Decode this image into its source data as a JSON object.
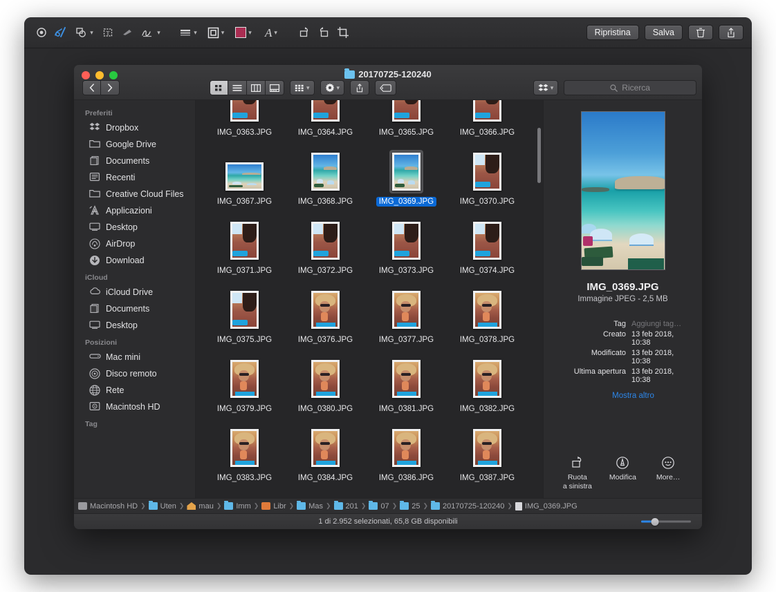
{
  "markup_toolbar": {
    "tools": [
      {
        "name": "instant-alpha-icon",
        "glyph": "◉"
      },
      {
        "name": "sketch-icon",
        "glyph": "✑"
      },
      {
        "name": "shapes-icon",
        "glyph": "⬠",
        "menu": true
      },
      {
        "name": "text-icon",
        "glyph": "T",
        "menu": false
      },
      {
        "name": "highlight-icon",
        "glyph": "▰"
      },
      {
        "name": "signature-icon",
        "glyph": "✍",
        "menu": true
      },
      {
        "name": "shape-style-icon",
        "glyph": "≡",
        "menu": true
      },
      {
        "name": "border-style-icon",
        "glyph": "▣",
        "menu": true
      },
      {
        "name": "fill-color-icon",
        "glyph": "",
        "menu": true
      },
      {
        "name": "text-style-icon",
        "glyph": "A",
        "menu": true
      },
      {
        "name": "rotate-left-icon",
        "glyph": "↺"
      },
      {
        "name": "rotate-right-icon",
        "glyph": "↻"
      },
      {
        "name": "crop-icon",
        "glyph": "⌗"
      }
    ],
    "fill_color": "#a92d52",
    "restore_label": "Ripristina",
    "save_label": "Salva",
    "delete_icon": "trash-icon",
    "share_icon": "share-icon"
  },
  "finder": {
    "title": "20170725-120240",
    "nav": {
      "back": "‹",
      "forward": "›"
    },
    "view_modes": [
      {
        "name": "icon-view",
        "active": true
      },
      {
        "name": "list-view",
        "active": false
      },
      {
        "name": "column-view",
        "active": false
      },
      {
        "name": "gallery-view",
        "active": false
      }
    ],
    "toolbar_buttons": [
      {
        "name": "arrange-by-button",
        "menu": true
      },
      {
        "name": "action-gear-button",
        "menu": true
      },
      {
        "name": "share-button",
        "menu": false
      },
      {
        "name": "tag-button",
        "menu": false
      },
      {
        "name": "dropbox-button",
        "menu": true
      }
    ],
    "search": {
      "placeholder": "Ricerca",
      "value": "",
      "icon": "search-icon"
    },
    "sidebar": {
      "sections": [
        {
          "title": "Preferiti",
          "items": [
            {
              "label": "Dropbox",
              "icon": "dropbox-icon"
            },
            {
              "label": "Google Drive",
              "icon": "folder-icon"
            },
            {
              "label": "Documents",
              "icon": "documents-icon"
            },
            {
              "label": "Recenti",
              "icon": "recents-icon"
            },
            {
              "label": "Creative Cloud Files",
              "icon": "folder-icon"
            },
            {
              "label": "Applicazioni",
              "icon": "applications-icon"
            },
            {
              "label": "Desktop",
              "icon": "desktop-icon"
            },
            {
              "label": "AirDrop",
              "icon": "airdrop-icon"
            },
            {
              "label": "Download",
              "icon": "download-icon"
            }
          ]
        },
        {
          "title": "iCloud",
          "items": [
            {
              "label": "iCloud Drive",
              "icon": "cloud-icon"
            },
            {
              "label": "Documents",
              "icon": "documents-icon"
            },
            {
              "label": "Desktop",
              "icon": "desktop-icon"
            }
          ]
        },
        {
          "title": "Posizioni",
          "items": [
            {
              "label": "Mac mini",
              "icon": "mac-mini-icon"
            },
            {
              "label": "Disco remoto",
              "icon": "remote-disc-icon"
            },
            {
              "label": "Rete",
              "icon": "network-icon"
            },
            {
              "label": "Macintosh HD",
              "icon": "hard-disk-icon"
            }
          ]
        },
        {
          "title": "Tag",
          "items": []
        }
      ]
    },
    "files": [
      {
        "name": "IMG_0363.JPG",
        "kind": "portrait",
        "photo": "selfie",
        "selected": false,
        "clipped": true
      },
      {
        "name": "IMG_0364.JPG",
        "kind": "portrait",
        "photo": "selfie",
        "selected": false,
        "clipped": true
      },
      {
        "name": "IMG_0365.JPG",
        "kind": "portrait",
        "photo": "selfie",
        "selected": false,
        "clipped": true
      },
      {
        "name": "IMG_0366.JPG",
        "kind": "portrait",
        "photo": "selfie",
        "selected": false,
        "clipped": true
      },
      {
        "name": "IMG_0367.JPG",
        "kind": "landscape",
        "photo": "beach",
        "selected": false,
        "clipped": false
      },
      {
        "name": "IMG_0368.JPG",
        "kind": "portrait",
        "photo": "beach",
        "selected": false,
        "clipped": false
      },
      {
        "name": "IMG_0369.JPG",
        "kind": "portrait",
        "photo": "beach",
        "selected": true,
        "clipped": false
      },
      {
        "name": "IMG_0370.JPG",
        "kind": "portrait",
        "photo": "selfie",
        "selected": false,
        "clipped": false
      },
      {
        "name": "IMG_0371.JPG",
        "kind": "portrait",
        "photo": "selfie",
        "selected": false,
        "clipped": false
      },
      {
        "name": "IMG_0372.JPG",
        "kind": "portrait",
        "photo": "selfie",
        "selected": false,
        "clipped": false
      },
      {
        "name": "IMG_0373.JPG",
        "kind": "portrait",
        "photo": "selfie",
        "selected": false,
        "clipped": false
      },
      {
        "name": "IMG_0374.JPG",
        "kind": "portrait",
        "photo": "selfie",
        "selected": false,
        "clipped": false
      },
      {
        "name": "IMG_0375.JPG",
        "kind": "portrait",
        "photo": "selfie",
        "selected": false,
        "clipped": false
      },
      {
        "name": "IMG_0376.JPG",
        "kind": "portrait",
        "photo": "portrait",
        "selected": false,
        "clipped": false
      },
      {
        "name": "IMG_0377.JPG",
        "kind": "portrait",
        "photo": "portrait",
        "selected": false,
        "clipped": false
      },
      {
        "name": "IMG_0378.JPG",
        "kind": "portrait",
        "photo": "portrait",
        "selected": false,
        "clipped": false
      },
      {
        "name": "IMG_0379.JPG",
        "kind": "portrait",
        "photo": "portrait",
        "selected": false,
        "clipped": false
      },
      {
        "name": "IMG_0380.JPG",
        "kind": "portrait",
        "photo": "portrait",
        "selected": false,
        "clipped": false
      },
      {
        "name": "IMG_0381.JPG",
        "kind": "portrait",
        "photo": "portrait",
        "selected": false,
        "clipped": false
      },
      {
        "name": "IMG_0382.JPG",
        "kind": "portrait",
        "photo": "portrait",
        "selected": false,
        "clipped": false
      },
      {
        "name": "IMG_0383.JPG",
        "kind": "portrait",
        "photo": "portrait",
        "selected": false,
        "clipped": false
      },
      {
        "name": "IMG_0384.JPG",
        "kind": "portrait",
        "photo": "portrait",
        "selected": false,
        "clipped": false
      },
      {
        "name": "IMG_0386.JPG",
        "kind": "portrait",
        "photo": "portrait",
        "selected": false,
        "clipped": false
      },
      {
        "name": "IMG_0387.JPG",
        "kind": "portrait",
        "photo": "portrait",
        "selected": false,
        "clipped": false
      }
    ],
    "preview": {
      "filename": "IMG_0369.JPG",
      "kind": "Immagine JPEG - 2,5 MB",
      "metadata": [
        {
          "key": "Tag",
          "value": "Aggiungi tag…",
          "placeholder": true
        },
        {
          "key": "Creato",
          "value": "13 feb 2018, 10:38",
          "placeholder": false
        },
        {
          "key": "Modificato",
          "value": "13 feb 2018, 10:38",
          "placeholder": false
        },
        {
          "key": "Ultima apertura",
          "value": "13 feb 2018, 10:38",
          "placeholder": false
        }
      ],
      "show_more": "Mostra altro",
      "quick_actions": [
        {
          "label": "Ruota\na sinistra",
          "label_line1": "Ruota",
          "label_line2": "a sinistra",
          "icon": "rotate-left-icon"
        },
        {
          "label": "Modifica",
          "label_line1": "Modifica",
          "label_line2": "",
          "icon": "markup-icon"
        },
        {
          "label": "More…",
          "label_line1": "More…",
          "label_line2": "",
          "icon": "more-icon"
        }
      ]
    },
    "path_bar": [
      {
        "label": "Macintosh HD",
        "icon": "hard-disk-icon"
      },
      {
        "label": "Uten",
        "icon": "folder-icon"
      },
      {
        "label": "mau",
        "icon": "home-icon"
      },
      {
        "label": "Imm",
        "icon": "folder-icon"
      },
      {
        "label": "Libr",
        "icon": "photos-icon"
      },
      {
        "label": "Mas",
        "icon": "folder-icon"
      },
      {
        "label": "201",
        "icon": "folder-icon"
      },
      {
        "label": "07",
        "icon": "folder-icon"
      },
      {
        "label": "25",
        "icon": "folder-icon"
      },
      {
        "label": "20170725-120240",
        "icon": "folder-icon"
      },
      {
        "label": "IMG_0369.JPG",
        "icon": "document-icon"
      }
    ],
    "status": {
      "text": "1 di 2.952 selezionati, 65,8 GB disponibili",
      "zoom_percent": 28
    }
  }
}
